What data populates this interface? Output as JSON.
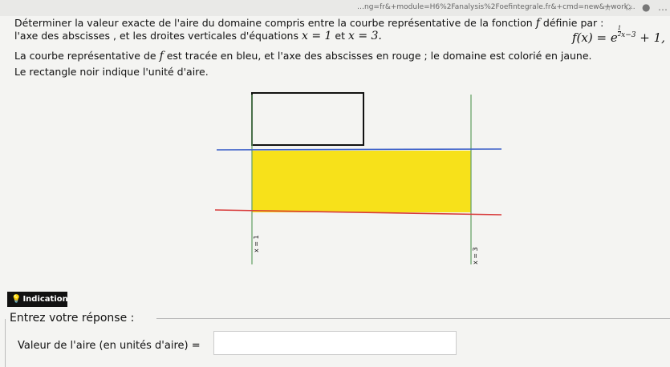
{
  "browser": {
    "url": "…ng=fr&+module=H6%2Fanalysis%2Foefintegrale.fr&+cmd=new&+work..."
  },
  "exercise": {
    "line1": "Déterminer la valeur exacte de l'aire du domaine compris entre la courbe représentative de la fonction",
    "f_letter": "f",
    "definie_par": "définie par :",
    "fx_lhs": "f(x) = e",
    "fx_exp_num": "1",
    "fx_exp_den": "2",
    "fx_exp_rest": "x−3",
    "fx_tail": "+ 1,",
    "line2_start": "l'axe des abscisses , et les droites verticales d'équations",
    "x1": "x = 1",
    "et": "et",
    "x3": "x = 3.",
    "line3_start": "La courbe représentative de",
    "line3_rest": "est tracée en bleu, et l'axe des abscisses en rouge ; le domaine est colorié en jaune.",
    "line4": "Le rectangle noir indique l'unité d'aire."
  },
  "figure": {
    "label_x1": "x = 1",
    "label_x3": "x = 3",
    "colors": {
      "curve": "#3a5ec8",
      "axis": "#d83a3a",
      "domain": "#f7e11a",
      "vertical": "#6aa56a",
      "unit_rect": "#111111"
    }
  },
  "indication": {
    "icon": "lightbulb-icon",
    "label": "Indication"
  },
  "answer": {
    "title": "Entrez votre réponse :",
    "label": "Valeur de l'aire (en unités d'aire) =",
    "value": ""
  }
}
